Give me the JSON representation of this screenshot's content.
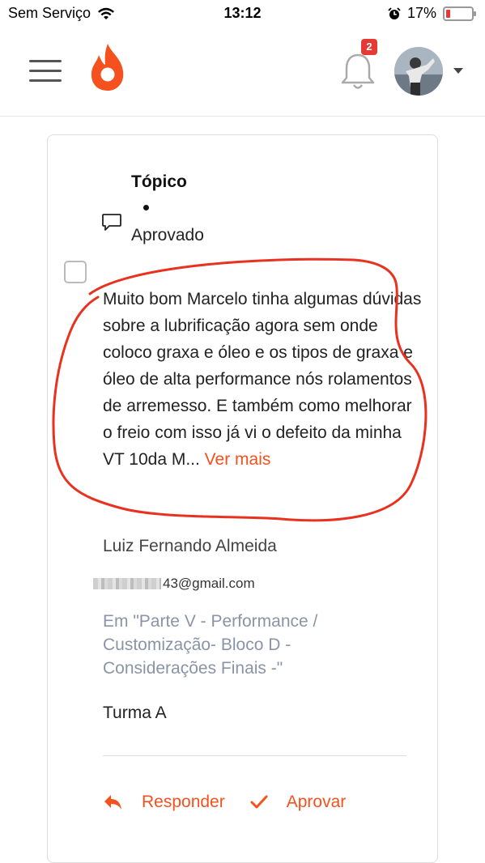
{
  "status_bar": {
    "carrier": "Sem Serviço",
    "time": "13:12",
    "battery": "17%",
    "battery_level": 0.17
  },
  "header": {
    "notifications_count": "2",
    "colors": {
      "brand": "#f4511e",
      "badge": "#e53935"
    }
  },
  "post": {
    "title": "Tópico",
    "status": "Aprovado",
    "message": "Muito bom Marcelo tinha algumas dúvidas sobre a lubrificação agora sem onde coloco graxa e óleo e os tipos de graxa e óleo de alta performance nós rolamentos de arremesso. E também como melhorar o freio com isso já vi o defeito da minha VT 10da M... ",
    "read_more": "Ver mais",
    "author": "Luiz Fernando Almeida",
    "email_visible": "43@gmail.com",
    "course": "Em \"Parte V - Performance / Customização- Bloco D - Considerações Finais -\"",
    "class_name": "Turma A"
  },
  "actions": {
    "reply": "Responder",
    "approve": "Aprovar"
  }
}
